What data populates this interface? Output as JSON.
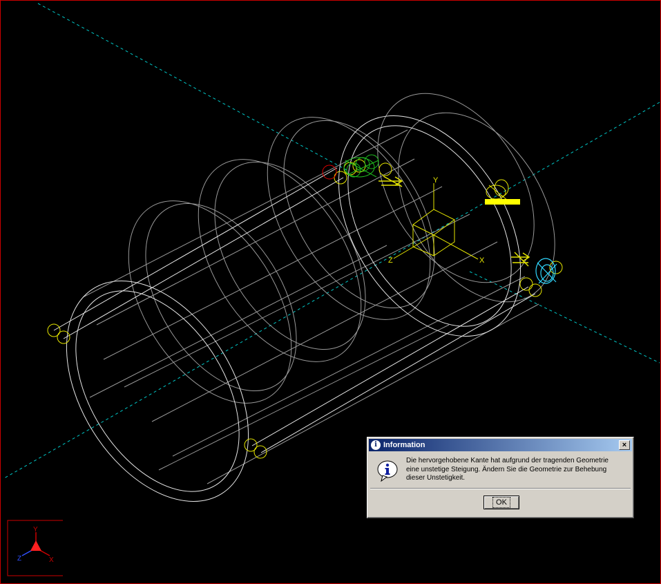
{
  "viewport": {
    "background": "#000000",
    "frame_color": "#cc0000",
    "axis_labels": {
      "x": "X",
      "y": "Y",
      "z": "Z"
    },
    "triad_labels": {
      "x": "X",
      "y": "Y",
      "z": "Z"
    }
  },
  "dialog": {
    "title": "Information",
    "title_icon": "info-icon",
    "message_lines": [
      "Die hervorgehobene Kante hat aufgrund der tragenden Geometrie",
      "eine unstetige Steigung. Ändern Sie die Geometrie zur Behebung",
      "dieser Unstetigkeit."
    ],
    "ok_label": "OK",
    "close_label": "×",
    "icon": "information-balloon-icon"
  }
}
